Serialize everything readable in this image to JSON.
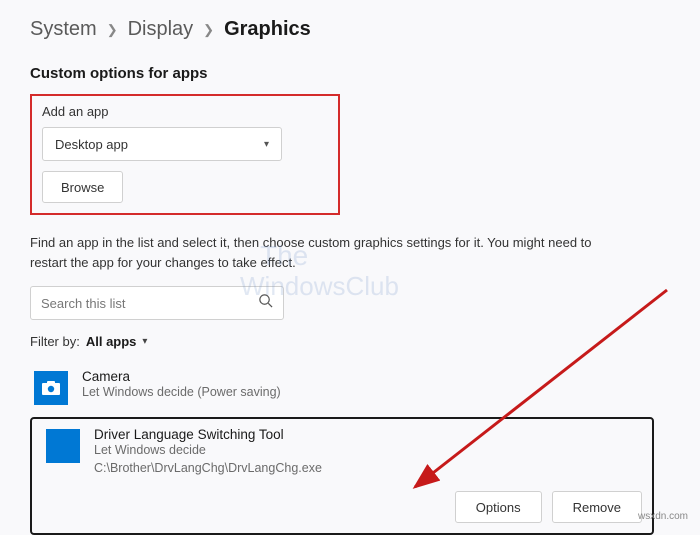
{
  "breadcrumb": {
    "level1": "System",
    "level2": "Display",
    "level3": "Graphics"
  },
  "section_title": "Custom options for apps",
  "add_app": {
    "label": "Add an app",
    "dropdown_value": "Desktop app",
    "browse": "Browse"
  },
  "helper": "Find an app in the list and select it, then choose custom graphics settings for it. You might need to restart the app for your changes to take effect.",
  "search": {
    "placeholder": "Search this list"
  },
  "filter": {
    "label": "Filter by:",
    "value": "All apps"
  },
  "apps": [
    {
      "name": "Camera",
      "desc": "Let Windows decide (Power saving)"
    },
    {
      "name": "Driver Language Switching Tool",
      "desc1": "Let Windows decide",
      "desc2": "C:\\Brother\\DrvLangChg\\DrvLangChg.exe"
    }
  ],
  "buttons": {
    "options": "Options",
    "remove": "Remove"
  },
  "watermark": {
    "line1": "The",
    "line2": "WindowsClub"
  },
  "attribution": "wsxdn.com"
}
